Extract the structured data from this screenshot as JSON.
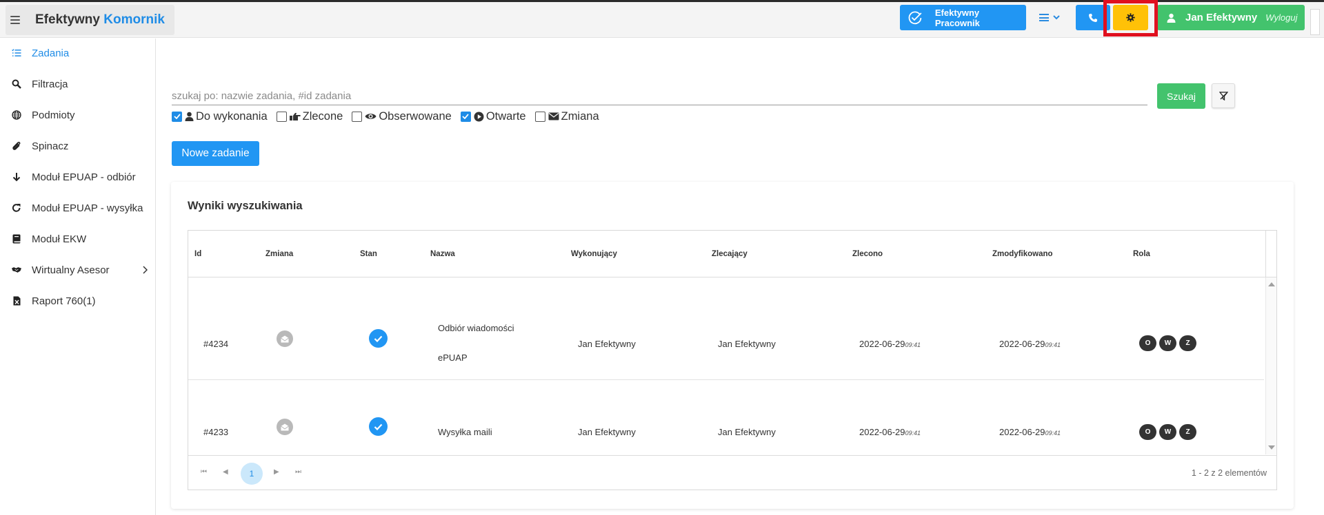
{
  "brand": {
    "name": "Efektywny",
    "accent": "Komornik"
  },
  "header": {
    "employee_button": "Efektywny Pracownik",
    "user_name": "Jan Efektywny",
    "logout_label": "Wyloguj"
  },
  "sidebar": {
    "items": [
      {
        "label": "Zadania",
        "icon": "list-check-icon",
        "active": true
      },
      {
        "label": "Filtracja",
        "icon": "search-icon"
      },
      {
        "label": "Podmioty",
        "icon": "globe-icon"
      },
      {
        "label": "Spinacz",
        "icon": "paperclip-icon"
      },
      {
        "label": "Moduł EPUAP - odbiór",
        "icon": "arrow-down-icon"
      },
      {
        "label": "Moduł EPUAP - wysyłka",
        "icon": "redo-icon"
      },
      {
        "label": "Moduł EKW",
        "icon": "book-icon"
      },
      {
        "label": "Wirtualny Asesor",
        "icon": "handshake-icon",
        "has_submenu": true
      },
      {
        "label": "Raport 760(1)",
        "icon": "excel-file-icon"
      }
    ]
  },
  "search": {
    "placeholder": "szukaj po: nazwie zadania, #id zadania",
    "value": "",
    "submit_label": "Szukaj"
  },
  "filters": [
    {
      "label": "Do wykonania",
      "checked": true,
      "icon": "user-icon"
    },
    {
      "label": "Zlecone",
      "checked": false,
      "icon": "hand-pointing-icon"
    },
    {
      "label": "Obserwowane",
      "checked": false,
      "icon": "eye-icon"
    },
    {
      "label": "Otwarte",
      "checked": true,
      "icon": "play-circle-icon"
    },
    {
      "label": "Zmiana",
      "checked": false,
      "icon": "envelope-icon"
    }
  ],
  "new_task_label": "Nowe zadanie",
  "results": {
    "title": "Wyniki wyszukiwania",
    "columns": [
      "Id",
      "Zmiana",
      "Stan",
      "Nazwa",
      "Wykonujący",
      "Zlecający",
      "Zlecono",
      "Zmodyfikowano",
      "Rola"
    ],
    "rows": [
      {
        "id": "#4234",
        "name_line1": "Odbiór wiadomości",
        "name_line2": "ePUAP",
        "executor": "Jan Efektywny",
        "assigner": "Jan Efektywny",
        "ordered_date": "2022-06-29",
        "ordered_time": "09:41",
        "modified_date": "2022-06-29",
        "modified_time": "09:41",
        "roles": [
          "O",
          "W",
          "Z"
        ]
      },
      {
        "id": "#4233",
        "name_line1": "Wysyłka maili",
        "name_line2": "",
        "executor": "Jan Efektywny",
        "assigner": "Jan Efektywny",
        "ordered_date": "2022-06-29",
        "ordered_time": "09:41",
        "modified_date": "2022-06-29",
        "modified_time": "09:41",
        "roles": [
          "O",
          "W",
          "Z"
        ]
      }
    ],
    "pager": {
      "current_page": "1",
      "info": "1 - 2 z 2 elementów"
    }
  },
  "colors": {
    "primary": "#2196f3",
    "success": "#43c36d",
    "warning": "#ffc107",
    "highlight": "#e0101f"
  }
}
